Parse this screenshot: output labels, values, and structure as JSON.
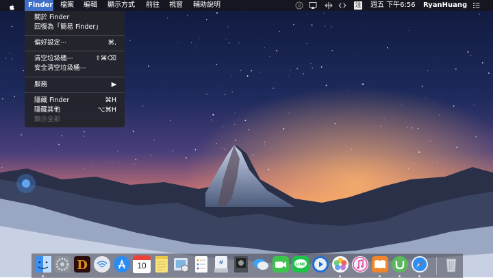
{
  "menubar": {
    "app_name": "Finder",
    "menus": [
      "檔案",
      "編輯",
      "顯示方式",
      "前往",
      "視窗",
      "輔助說明"
    ],
    "input_method": "注",
    "clock": "週五 下午6:56",
    "username": "RyanHuang"
  },
  "finder_menu": {
    "about": "關於 Finder",
    "simple_finder": "回復為「簡易 Finder」",
    "preferences": "偏好設定⋯",
    "preferences_shortcut": "⌘,",
    "empty_trash": "清空垃圾桶⋯",
    "empty_trash_shortcut": "⇧⌘⌫",
    "secure_empty_trash": "安全清空垃圾桶⋯",
    "services": "服務",
    "hide_finder": "隱藏 Finder",
    "hide_finder_shortcut": "⌘H",
    "hide_others": "隱藏其他",
    "hide_others_shortcut": "⌥⌘H",
    "show_all": "顯示全部"
  },
  "dock": {
    "calendar_day": "10"
  },
  "colors": {
    "menu_highlight": "#3f6fc6",
    "menubar_bg": "#16161c",
    "disabled_text": "#6d6d74"
  }
}
